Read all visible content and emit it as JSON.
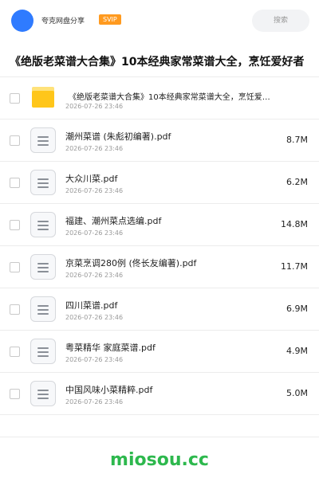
{
  "header": {
    "brand": "夸克网盘分享",
    "badge": "SVIP",
    "search_label": "搜索"
  },
  "title": "《绝版老菜谱大合集》10本经典家常菜谱大全，烹饪爱好者",
  "folder": {
    "name": "《绝版老菜谱大合集》10本经典家常菜谱大全，烹饪爱…",
    "date": "2026-07-26 23:46"
  },
  "files": [
    {
      "name": "潮州菜谱 (朱彪初编著).pdf",
      "date": "2026-07-26 23:46",
      "size": "8.7M"
    },
    {
      "name": "大众川菜.pdf",
      "date": "2026-07-26 23:46",
      "size": "6.2M"
    },
    {
      "name": "福建、潮州菜点选编.pdf",
      "date": "2026-07-26 23:46",
      "size": "14.8M"
    },
    {
      "name": "京菜烹调280例 (佟长友编著).pdf",
      "date": "2026-07-26 23:46",
      "size": "11.7M"
    },
    {
      "name": "四川菜谱.pdf",
      "date": "2026-07-26 23:46",
      "size": "6.9M"
    },
    {
      "name": "粤菜精华 家庭菜谱.pdf",
      "date": "2026-07-26 23:46",
      "size": "4.9M"
    },
    {
      "name": "中国风味小菜精粹.pdf",
      "date": "2026-07-26 23:46",
      "size": "5.0M"
    }
  ],
  "footer": {
    "logo": "miosou.cc"
  },
  "colors": {
    "avatar": "#2f7bff",
    "badge": "#ff9a1f",
    "folder": "#ffc61a",
    "logo": "#2db84d"
  }
}
